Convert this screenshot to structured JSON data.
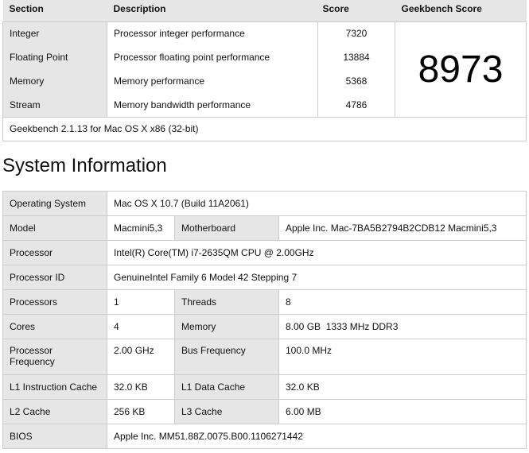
{
  "score_table": {
    "headers": {
      "section": "Section",
      "description": "Description",
      "score": "Score",
      "geekbench_score": "Geekbench Score"
    },
    "rows": [
      {
        "section": "Integer",
        "description": "Processor integer performance",
        "score": "7320"
      },
      {
        "section": "Floating Point",
        "description": "Processor floating point performance",
        "score": "13884"
      },
      {
        "section": "Memory",
        "description": "Memory performance",
        "score": "5368"
      },
      {
        "section": "Stream",
        "description": "Memory bandwidth performance",
        "score": "4786"
      }
    ],
    "geekbench_score": "8973",
    "footer": "Geekbench 2.1.13 for Mac OS X x86 (32-bit)"
  },
  "system_info": {
    "title": "System Information",
    "operating_system": {
      "label": "Operating System",
      "value": "Mac OS X 10.7 (Build 11A2061)"
    },
    "model": {
      "label": "Model",
      "value": "Macmini5,3"
    },
    "motherboard": {
      "label": "Motherboard",
      "value": "Apple Inc. Mac-7BA5B2794B2CDB12 Macmini5,3"
    },
    "processor": {
      "label": "Processor",
      "value": "Intel(R) Core(TM) i7-2635QM CPU @ 2.00GHz"
    },
    "processor_id": {
      "label": "Processor ID",
      "value": "GenuineIntel Family 6 Model 42 Stepping 7"
    },
    "processors": {
      "label": "Processors",
      "value": "1"
    },
    "threads": {
      "label": "Threads",
      "value": "8"
    },
    "cores": {
      "label": "Cores",
      "value": "4"
    },
    "memory": {
      "label": "Memory",
      "value": "8.00 GB  1333 MHz DDR3"
    },
    "processor_frequency": {
      "label": "Processor Frequency",
      "value": "2.00 GHz"
    },
    "bus_frequency": {
      "label": "Bus Frequency",
      "value": "100.0 MHz"
    },
    "l1_instruction_cache": {
      "label": "L1 Instruction Cache",
      "value": "32.0 KB"
    },
    "l1_data_cache": {
      "label": "L1 Data Cache",
      "value": "32.0 KB"
    },
    "l2_cache": {
      "label": "L2 Cache",
      "value": "256 KB"
    },
    "l3_cache": {
      "label": "L3 Cache",
      "value": "6.00 MB"
    },
    "bios": {
      "label": "BIOS",
      "value": "Apple Inc. MM51.88Z.0075.B00.1106271442"
    }
  }
}
